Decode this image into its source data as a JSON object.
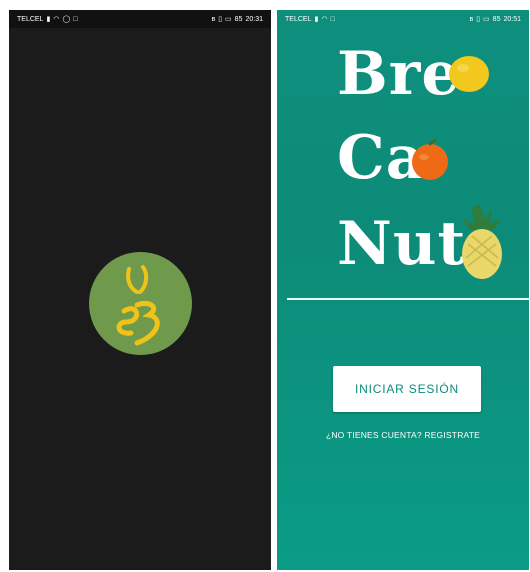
{
  "splash_screen": {
    "status_bar": {
      "carrier": "TELCEL",
      "time": "20:31",
      "battery": "85"
    },
    "logo": {
      "name": "brecanut-logo",
      "accent": "#f0c31a",
      "background": "#6f9a4c"
    }
  },
  "login_screen": {
    "status_bar": {
      "carrier": "TELCEL",
      "time": "20:51",
      "battery": "85"
    },
    "brand": {
      "line1": "Bre",
      "line2": "Ca",
      "line3": "Nut"
    },
    "login_button_label": "INICIAR SESIÓN",
    "register_link_text": "¿NO TIENES CUENTA? REGISTRATE",
    "colors": {
      "background": "#0d8b79",
      "button": "#ffffff",
      "button_text": "#0d8b79"
    }
  }
}
